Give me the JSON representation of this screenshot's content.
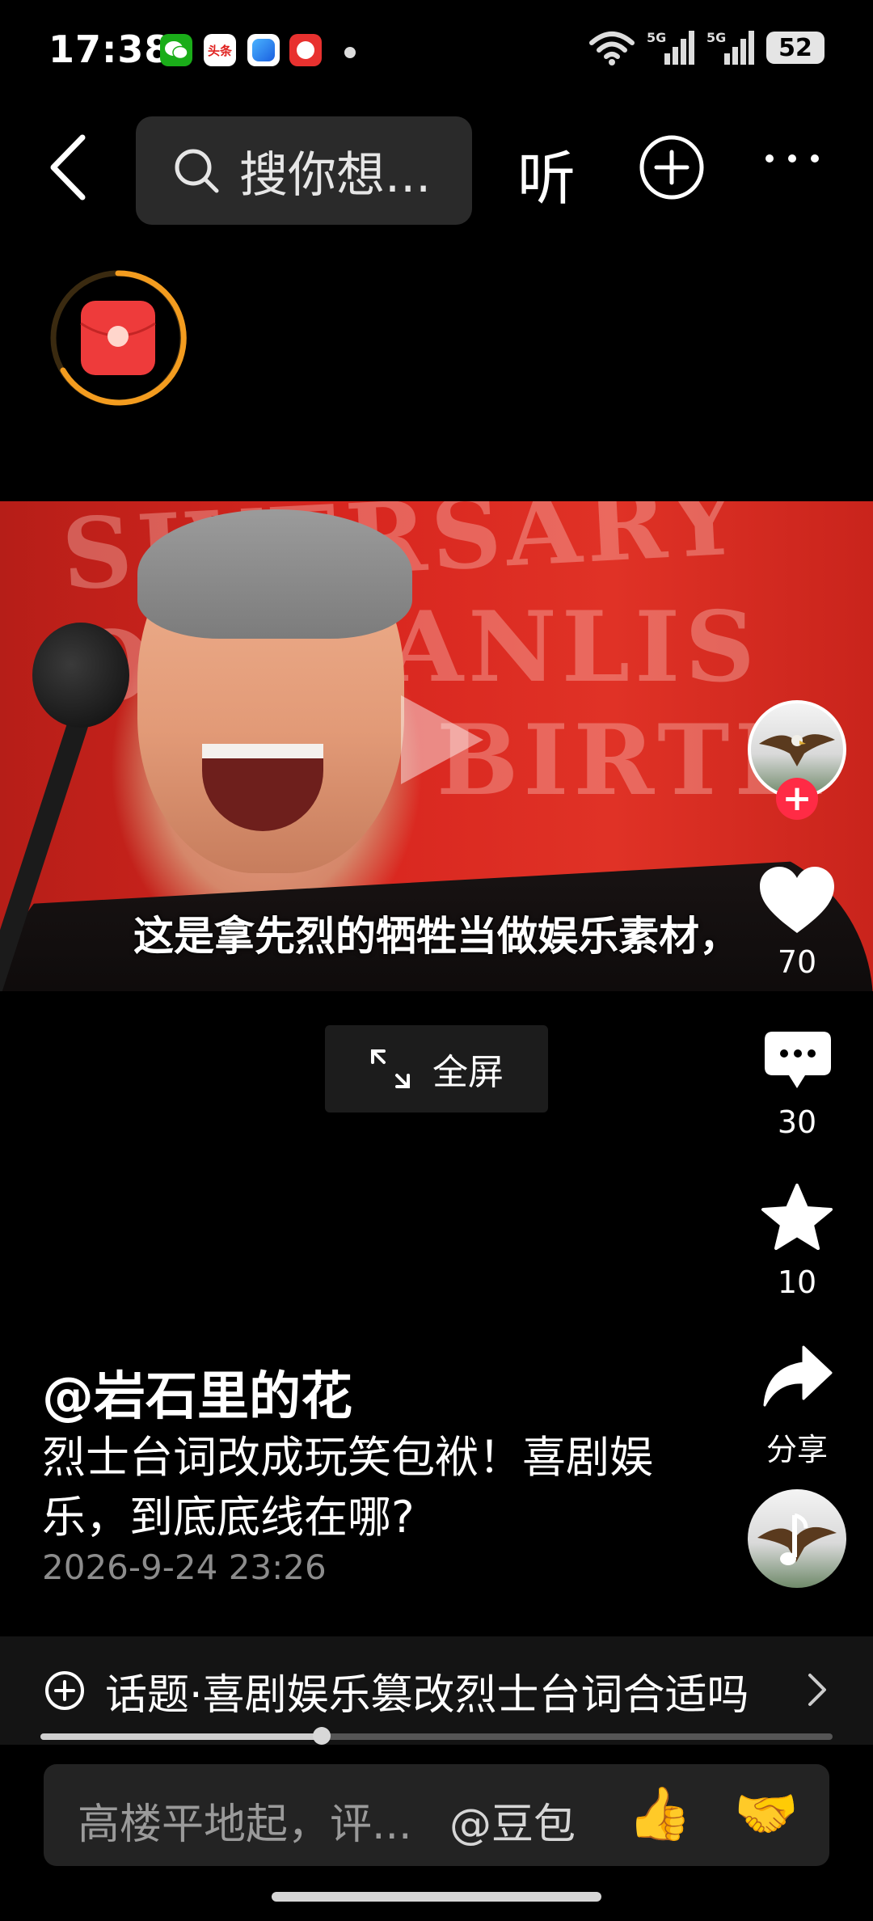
{
  "status_bar": {
    "time": "17:38",
    "app_icons": [
      "wechat-icon",
      "toutiao-icon",
      "browser-icon",
      "game-icon"
    ],
    "toutiao_label": "头条",
    "network": "5G",
    "battery": "52"
  },
  "top_nav": {
    "search_placeholder": "搜你想...",
    "listen_label": "听"
  },
  "video": {
    "subtitle": "这是拿先烈的牺牲当做娱乐素材，",
    "bg_words": [
      "SIVERSARY OF",
      "ANLIS",
      "BIRTH"
    ]
  },
  "fullscreen": {
    "label": "全屏"
  },
  "actions": {
    "likes": "70",
    "comments": "30",
    "favorites": "10",
    "share_label": "分享"
  },
  "post": {
    "author": "@岩石里的花",
    "description": "烈士台词改成玩笑包袱！喜剧娱乐，到底底线在哪?",
    "date": "2026-9-24 23:26"
  },
  "topic": {
    "label": "话题·喜剧娱乐篡改烈士台词合适吗"
  },
  "progress": {
    "fraction": 0.355
  },
  "comment": {
    "placeholder": "高楼平地起，评...",
    "mention": "@豆包",
    "emoji_1": "👍",
    "emoji_2": "🤝"
  },
  "colors": {
    "accent_red": "#ff2b45",
    "redpack_orange": "#f39c1f"
  }
}
